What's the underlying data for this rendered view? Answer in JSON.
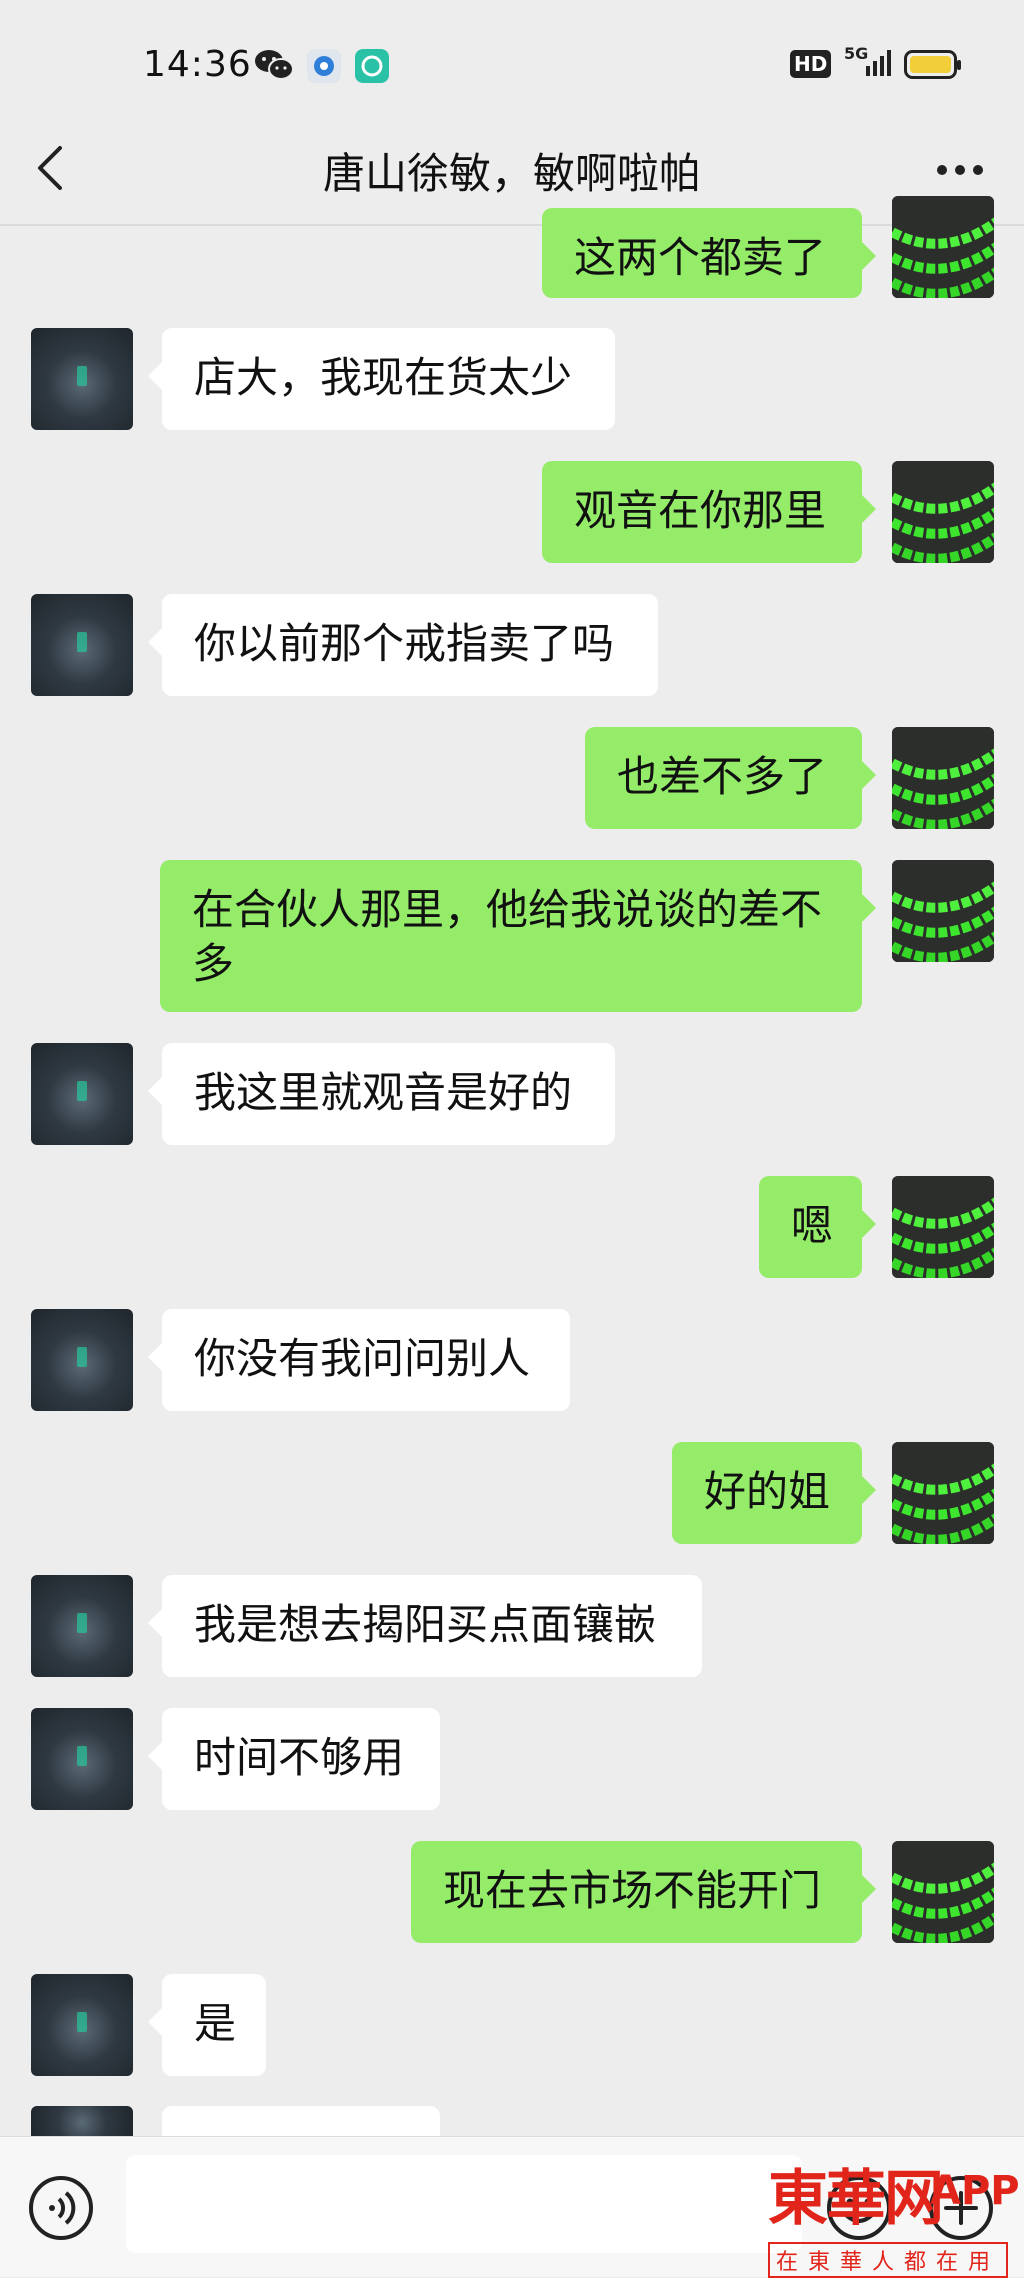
{
  "status_bar": {
    "time": "14:36",
    "hd": "HD",
    "network": "5G"
  },
  "header": {
    "title": "唐山徐敏，敏啊啦帕"
  },
  "messages": [
    {
      "from": "self",
      "text": "这两个都卖了"
    },
    {
      "from": "other",
      "text": "店大，我现在货太少"
    },
    {
      "from": "self",
      "text": "观音在你那里"
    },
    {
      "from": "other",
      "text": "你以前那个戒指卖了吗"
    },
    {
      "from": "self",
      "text": "也差不多了"
    },
    {
      "from": "self",
      "text": "在合伙人那里，他给我说谈的差不\n多"
    },
    {
      "from": "other",
      "text": "我这里就观音是好的"
    },
    {
      "from": "self",
      "text": "嗯"
    },
    {
      "from": "other",
      "text": "你没有我问问别人"
    },
    {
      "from": "self",
      "text": "好的姐"
    },
    {
      "from": "other",
      "text": "我是想去揭阳买点面镶嵌"
    },
    {
      "from": "other",
      "text": "时间不够用"
    },
    {
      "from": "self",
      "text": "现在去市场不能开门"
    },
    {
      "from": "other",
      "text": "是"
    }
  ],
  "watermark": {
    "brand": "東華网",
    "app": "APP",
    "slogan": "在東華人都在用"
  },
  "colors": {
    "outgoing": "#95ec69",
    "incoming": "#ffffff",
    "background": "#ededed"
  }
}
